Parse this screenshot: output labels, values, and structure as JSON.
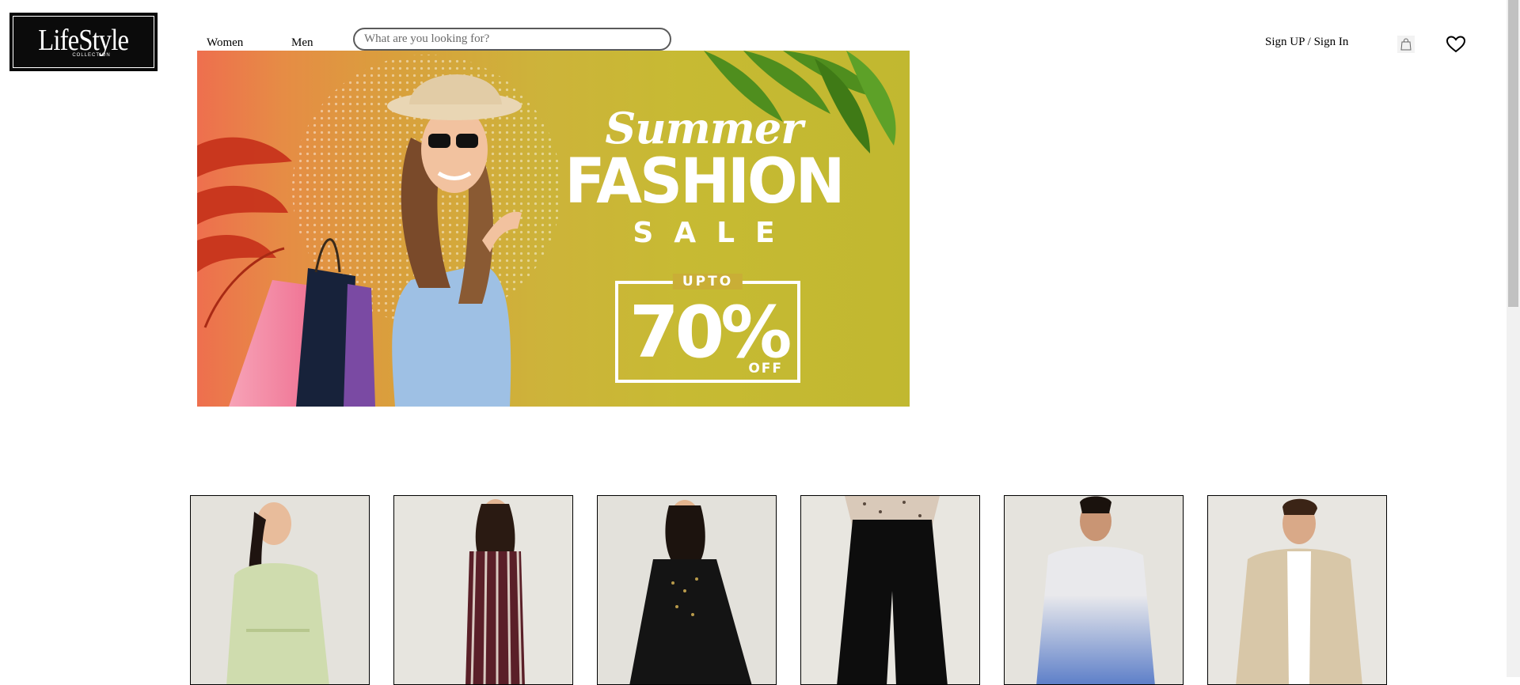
{
  "brand": {
    "name": "LifeStyle",
    "tagline": "COLLECTION"
  },
  "nav": {
    "women": "Women",
    "men": "Men"
  },
  "search": {
    "placeholder": "What are you looking for?",
    "value": ""
  },
  "account": {
    "sign_up": "Sign UP",
    "separator": " / ",
    "sign_in": "Sign In"
  },
  "icons": {
    "cart": "shopping-bag-icon",
    "wishlist": "heart-icon"
  },
  "hero": {
    "line1": "Summer",
    "line2": "FASHION",
    "line3": "SALE",
    "upto": "UPTO",
    "percent": "70%",
    "off": "OFF",
    "colors": {
      "start": "#ee6f4e",
      "end": "#c1b830"
    }
  },
  "products": [
    {
      "name": "women-floral-dress",
      "outfit": "#cfdcae"
    },
    {
      "name": "women-striped-jumpsuit",
      "outfit": "#5a1f28"
    },
    {
      "name": "women-black-kurta-set",
      "outfit": "#141414"
    },
    {
      "name": "women-black-trousers",
      "outfit": "#0d0d0d"
    },
    {
      "name": "men-dip-dye-shirt",
      "outfit": "#7d9ad2"
    },
    {
      "name": "men-beige-jacket",
      "outfit": "#d8c7a8"
    }
  ]
}
